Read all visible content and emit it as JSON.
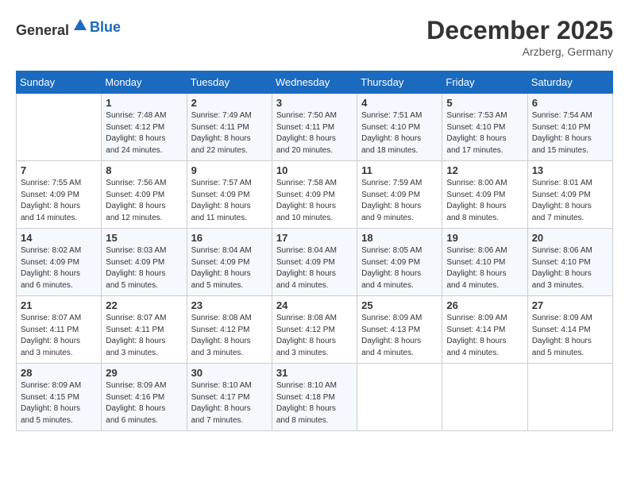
{
  "header": {
    "logo_general": "General",
    "logo_blue": "Blue",
    "month_year": "December 2025",
    "location": "Arzberg, Germany"
  },
  "days_of_week": [
    "Sunday",
    "Monday",
    "Tuesday",
    "Wednesday",
    "Thursday",
    "Friday",
    "Saturday"
  ],
  "weeks": [
    [
      {
        "day": "",
        "info": ""
      },
      {
        "day": "1",
        "info": "Sunrise: 7:48 AM\nSunset: 4:12 PM\nDaylight: 8 hours\nand 24 minutes."
      },
      {
        "day": "2",
        "info": "Sunrise: 7:49 AM\nSunset: 4:11 PM\nDaylight: 8 hours\nand 22 minutes."
      },
      {
        "day": "3",
        "info": "Sunrise: 7:50 AM\nSunset: 4:11 PM\nDaylight: 8 hours\nand 20 minutes."
      },
      {
        "day": "4",
        "info": "Sunrise: 7:51 AM\nSunset: 4:10 PM\nDaylight: 8 hours\nand 18 minutes."
      },
      {
        "day": "5",
        "info": "Sunrise: 7:53 AM\nSunset: 4:10 PM\nDaylight: 8 hours\nand 17 minutes."
      },
      {
        "day": "6",
        "info": "Sunrise: 7:54 AM\nSunset: 4:10 PM\nDaylight: 8 hours\nand 15 minutes."
      }
    ],
    [
      {
        "day": "7",
        "info": "Sunrise: 7:55 AM\nSunset: 4:09 PM\nDaylight: 8 hours\nand 14 minutes."
      },
      {
        "day": "8",
        "info": "Sunrise: 7:56 AM\nSunset: 4:09 PM\nDaylight: 8 hours\nand 12 minutes."
      },
      {
        "day": "9",
        "info": "Sunrise: 7:57 AM\nSunset: 4:09 PM\nDaylight: 8 hours\nand 11 minutes."
      },
      {
        "day": "10",
        "info": "Sunrise: 7:58 AM\nSunset: 4:09 PM\nDaylight: 8 hours\nand 10 minutes."
      },
      {
        "day": "11",
        "info": "Sunrise: 7:59 AM\nSunset: 4:09 PM\nDaylight: 8 hours\nand 9 minutes."
      },
      {
        "day": "12",
        "info": "Sunrise: 8:00 AM\nSunset: 4:09 PM\nDaylight: 8 hours\nand 8 minutes."
      },
      {
        "day": "13",
        "info": "Sunrise: 8:01 AM\nSunset: 4:09 PM\nDaylight: 8 hours\nand 7 minutes."
      }
    ],
    [
      {
        "day": "14",
        "info": "Sunrise: 8:02 AM\nSunset: 4:09 PM\nDaylight: 8 hours\nand 6 minutes."
      },
      {
        "day": "15",
        "info": "Sunrise: 8:03 AM\nSunset: 4:09 PM\nDaylight: 8 hours\nand 5 minutes."
      },
      {
        "day": "16",
        "info": "Sunrise: 8:04 AM\nSunset: 4:09 PM\nDaylight: 8 hours\nand 5 minutes."
      },
      {
        "day": "17",
        "info": "Sunrise: 8:04 AM\nSunset: 4:09 PM\nDaylight: 8 hours\nand 4 minutes."
      },
      {
        "day": "18",
        "info": "Sunrise: 8:05 AM\nSunset: 4:09 PM\nDaylight: 8 hours\nand 4 minutes."
      },
      {
        "day": "19",
        "info": "Sunrise: 8:06 AM\nSunset: 4:10 PM\nDaylight: 8 hours\nand 4 minutes."
      },
      {
        "day": "20",
        "info": "Sunrise: 8:06 AM\nSunset: 4:10 PM\nDaylight: 8 hours\nand 3 minutes."
      }
    ],
    [
      {
        "day": "21",
        "info": "Sunrise: 8:07 AM\nSunset: 4:11 PM\nDaylight: 8 hours\nand 3 minutes."
      },
      {
        "day": "22",
        "info": "Sunrise: 8:07 AM\nSunset: 4:11 PM\nDaylight: 8 hours\nand 3 minutes."
      },
      {
        "day": "23",
        "info": "Sunrise: 8:08 AM\nSunset: 4:12 PM\nDaylight: 8 hours\nand 3 minutes."
      },
      {
        "day": "24",
        "info": "Sunrise: 8:08 AM\nSunset: 4:12 PM\nDaylight: 8 hours\nand 3 minutes."
      },
      {
        "day": "25",
        "info": "Sunrise: 8:09 AM\nSunset: 4:13 PM\nDaylight: 8 hours\nand 4 minutes."
      },
      {
        "day": "26",
        "info": "Sunrise: 8:09 AM\nSunset: 4:14 PM\nDaylight: 8 hours\nand 4 minutes."
      },
      {
        "day": "27",
        "info": "Sunrise: 8:09 AM\nSunset: 4:14 PM\nDaylight: 8 hours\nand 5 minutes."
      }
    ],
    [
      {
        "day": "28",
        "info": "Sunrise: 8:09 AM\nSunset: 4:15 PM\nDaylight: 8 hours\nand 5 minutes."
      },
      {
        "day": "29",
        "info": "Sunrise: 8:09 AM\nSunset: 4:16 PM\nDaylight: 8 hours\nand 6 minutes."
      },
      {
        "day": "30",
        "info": "Sunrise: 8:10 AM\nSunset: 4:17 PM\nDaylight: 8 hours\nand 7 minutes."
      },
      {
        "day": "31",
        "info": "Sunrise: 8:10 AM\nSunset: 4:18 PM\nDaylight: 8 hours\nand 8 minutes."
      },
      {
        "day": "",
        "info": ""
      },
      {
        "day": "",
        "info": ""
      },
      {
        "day": "",
        "info": ""
      }
    ]
  ]
}
